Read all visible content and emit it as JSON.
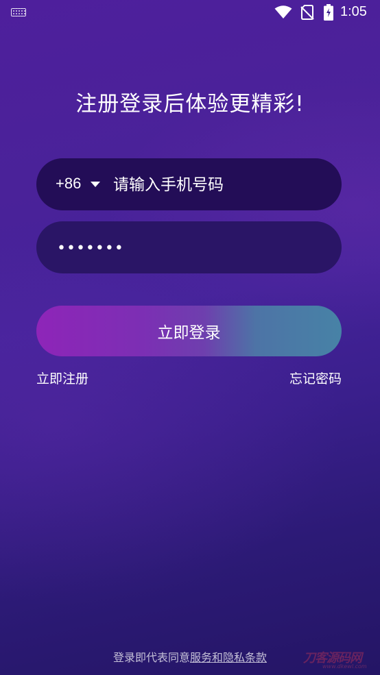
{
  "status_bar": {
    "time": "1:05",
    "icons": [
      "keyboard-icon",
      "wifi-icon",
      "no-sim-icon",
      "battery-icon"
    ]
  },
  "headline": "注册登录后体验更精彩!",
  "phone": {
    "country_code": "+86",
    "placeholder": "请输入手机号码",
    "value": ""
  },
  "password": {
    "value": "•••••••"
  },
  "login_button": "立即登录",
  "register_link": "立即注册",
  "forgot_link": "忘记密码",
  "footer": {
    "prefix": "登录即代表同意",
    "terms_link": "服务和隐私条款"
  },
  "watermark": {
    "logo_text": "刀客源码网",
    "sub_text": "www.dkewl.com"
  },
  "colors": {
    "background_top": "#4e1f9c",
    "background_bottom": "#241565",
    "phone_field": "#230d57",
    "password_field": "#2a1566",
    "button_gradient_start": "#8e25b8",
    "button_gradient_end": "#4782a6"
  }
}
